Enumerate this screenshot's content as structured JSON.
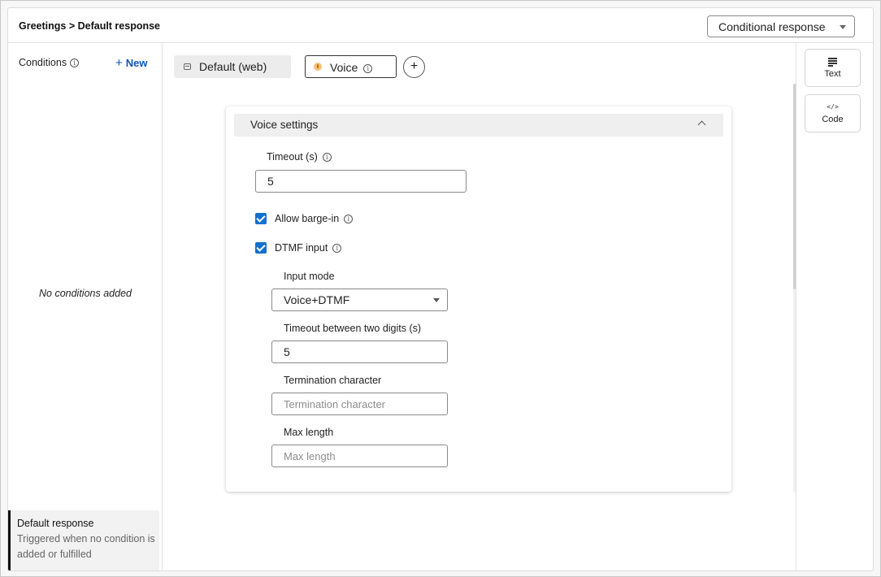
{
  "header": {
    "breadcrumb": "Greetings > Default response",
    "response_type": "Conditional response"
  },
  "conditions": {
    "label": "Conditions",
    "new_label": "New",
    "empty_text": "No conditions added",
    "default_response": {
      "title": "Default response",
      "description": "Triggered when no condition is added or fulfilled"
    }
  },
  "channels": {
    "tabs": [
      {
        "label": "Default (web)",
        "icon": "browser-icon",
        "selected": false
      },
      {
        "label": "Voice",
        "icon": "microphone-icon",
        "selected": true
      }
    ]
  },
  "voice_settings": {
    "title": "Voice settings",
    "expanded": true,
    "timeout": {
      "label": "Timeout (s)",
      "value": "5"
    },
    "allow_barge_in": {
      "label": "Allow barge-in",
      "checked": true
    },
    "dtmf_input": {
      "label": "DTMF input",
      "checked": true
    },
    "input_mode": {
      "label": "Input mode",
      "value": "Voice+DTMF"
    },
    "digit_timeout": {
      "label": "Timeout between two digits (s)",
      "value": "5"
    },
    "termination_character": {
      "label": "Termination character",
      "placeholder": "Termination character"
    },
    "max_length": {
      "label": "Max length",
      "placeholder": "Max length"
    }
  },
  "rail": {
    "text_label": "Text",
    "code_label": "Code",
    "code_icon_glyph": "</>"
  },
  "colors": {
    "accent": "#1170cf",
    "link": "#0a56b8"
  }
}
